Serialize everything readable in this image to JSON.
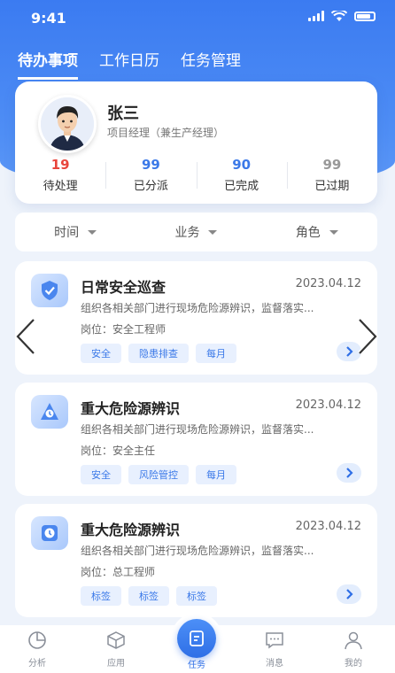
{
  "status": {
    "time": "9:41"
  },
  "tabs": [
    {
      "label": "待办事项",
      "active": true
    },
    {
      "label": "工作日历",
      "active": false
    },
    {
      "label": "任务管理",
      "active": false
    }
  ],
  "profile": {
    "name": "张三",
    "role": "项目经理（兼生产经理）",
    "stats": [
      {
        "value": "19",
        "label": "待处理",
        "color": "#e8453c"
      },
      {
        "value": "99",
        "label": "已分派",
        "color": "#3b79e8"
      },
      {
        "value": "90",
        "label": "已完成",
        "color": "#3b79e8"
      },
      {
        "value": "99",
        "label": "已过期",
        "color": "#999999"
      }
    ]
  },
  "filters": [
    {
      "label": "时间"
    },
    {
      "label": "业务"
    },
    {
      "label": "角色"
    }
  ],
  "tasks": [
    {
      "title": "日常安全巡查",
      "date": "2023.04.12",
      "desc": "组织各相关部门进行现场危险源辨识，监督落实...",
      "position": "岗位：安全工程师",
      "tags": [
        "安全",
        "隐患排查",
        "每月"
      ],
      "icon": "shield-icon"
    },
    {
      "title": "重大危险源辨识",
      "date": "2023.04.12",
      "desc": "组织各相关部门进行现场危险源辨识，监督落实...",
      "position": "岗位：安全主任",
      "tags": [
        "安全",
        "风险管控",
        "每月"
      ],
      "icon": "alert-icon"
    },
    {
      "title": "重大危险源辨识",
      "date": "2023.04.12",
      "desc": "组织各相关部门进行现场危险源辨识，监督落实...",
      "position": "岗位：总工程师",
      "tags": [
        "标签",
        "标签",
        "标签"
      ],
      "icon": "clock-icon"
    }
  ],
  "bottom_nav": [
    {
      "label": "分析",
      "icon": "chart-icon"
    },
    {
      "label": "应用",
      "icon": "cube-icon"
    },
    {
      "label": "任务",
      "icon": "task-icon",
      "active": true
    },
    {
      "label": "消息",
      "icon": "message-icon"
    },
    {
      "label": "我的",
      "icon": "user-icon"
    }
  ]
}
